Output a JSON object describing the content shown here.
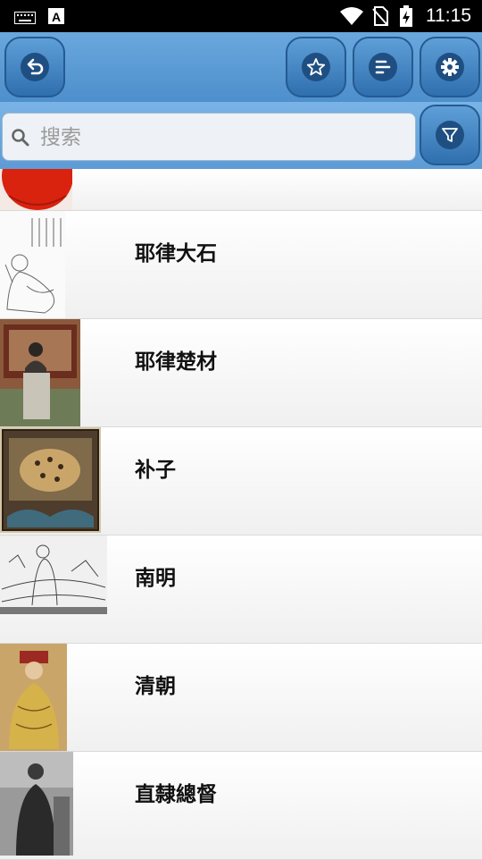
{
  "status_bar": {
    "time": "11:15"
  },
  "toolbar": {
    "back_icon": "back-arrow-icon",
    "star_icon": "star-icon",
    "sort_icon": "sort-list-icon",
    "settings_icon": "gear-icon"
  },
  "search": {
    "placeholder": "搜索",
    "value": ""
  },
  "list": {
    "items": [
      {
        "label": ""
      },
      {
        "label": "耶律大石"
      },
      {
        "label": "耶律楚材"
      },
      {
        "label": "补子"
      },
      {
        "label": "南明"
      },
      {
        "label": "清朝"
      },
      {
        "label": "直隸總督"
      }
    ]
  },
  "colors": {
    "toolbar_blue": "#4d8fcc",
    "button_dark": "#1f4f82"
  }
}
